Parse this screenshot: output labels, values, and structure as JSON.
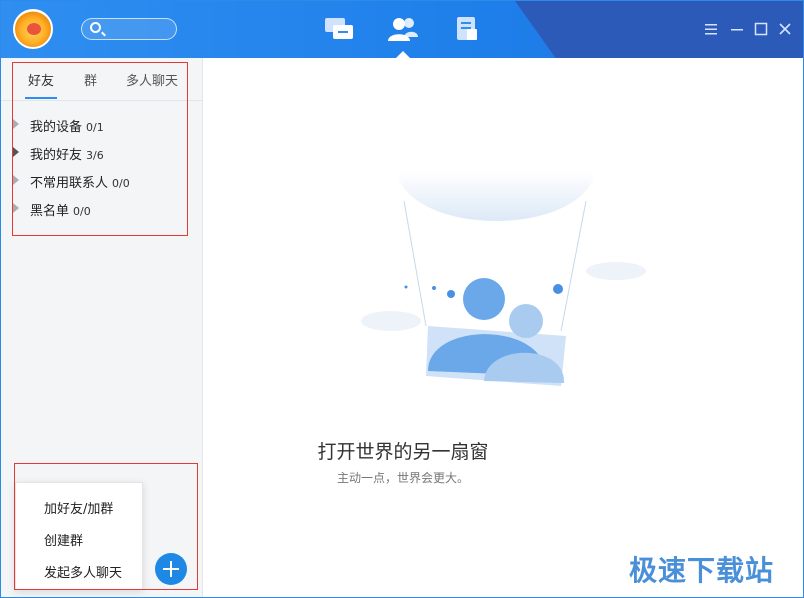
{
  "header": {
    "nav": [
      {
        "name": "messages",
        "icon": "chat-bubbles-icon"
      },
      {
        "name": "contacts",
        "icon": "contacts-icon",
        "active": true
      },
      {
        "name": "files",
        "icon": "document-icon"
      }
    ],
    "controls": [
      "menu-icon",
      "minimize-icon",
      "maximize-icon",
      "close-icon"
    ]
  },
  "sidebar": {
    "tabs": [
      {
        "label": "好友",
        "active": true
      },
      {
        "label": "群"
      },
      {
        "label": "多人聊天"
      }
    ],
    "groups": [
      {
        "label": "我的设备",
        "count": "0/1"
      },
      {
        "label": "我的好友",
        "count": "3/6"
      },
      {
        "label": "不常用联系人",
        "count": "0/0"
      },
      {
        "label": "黑名单",
        "count": "0/0"
      }
    ]
  },
  "popup_menu": {
    "items": [
      "加好友/加群",
      "创建群",
      "发起多人聊天"
    ]
  },
  "main": {
    "empty_title": "打开世界的另一扇窗",
    "empty_subtitle": "主动一点，世界会更大。"
  },
  "watermark": "极速下载站",
  "colors": {
    "accent": "#1e88e5",
    "highlight_box": "#e53935",
    "header_blue": "#2f8ef0"
  }
}
